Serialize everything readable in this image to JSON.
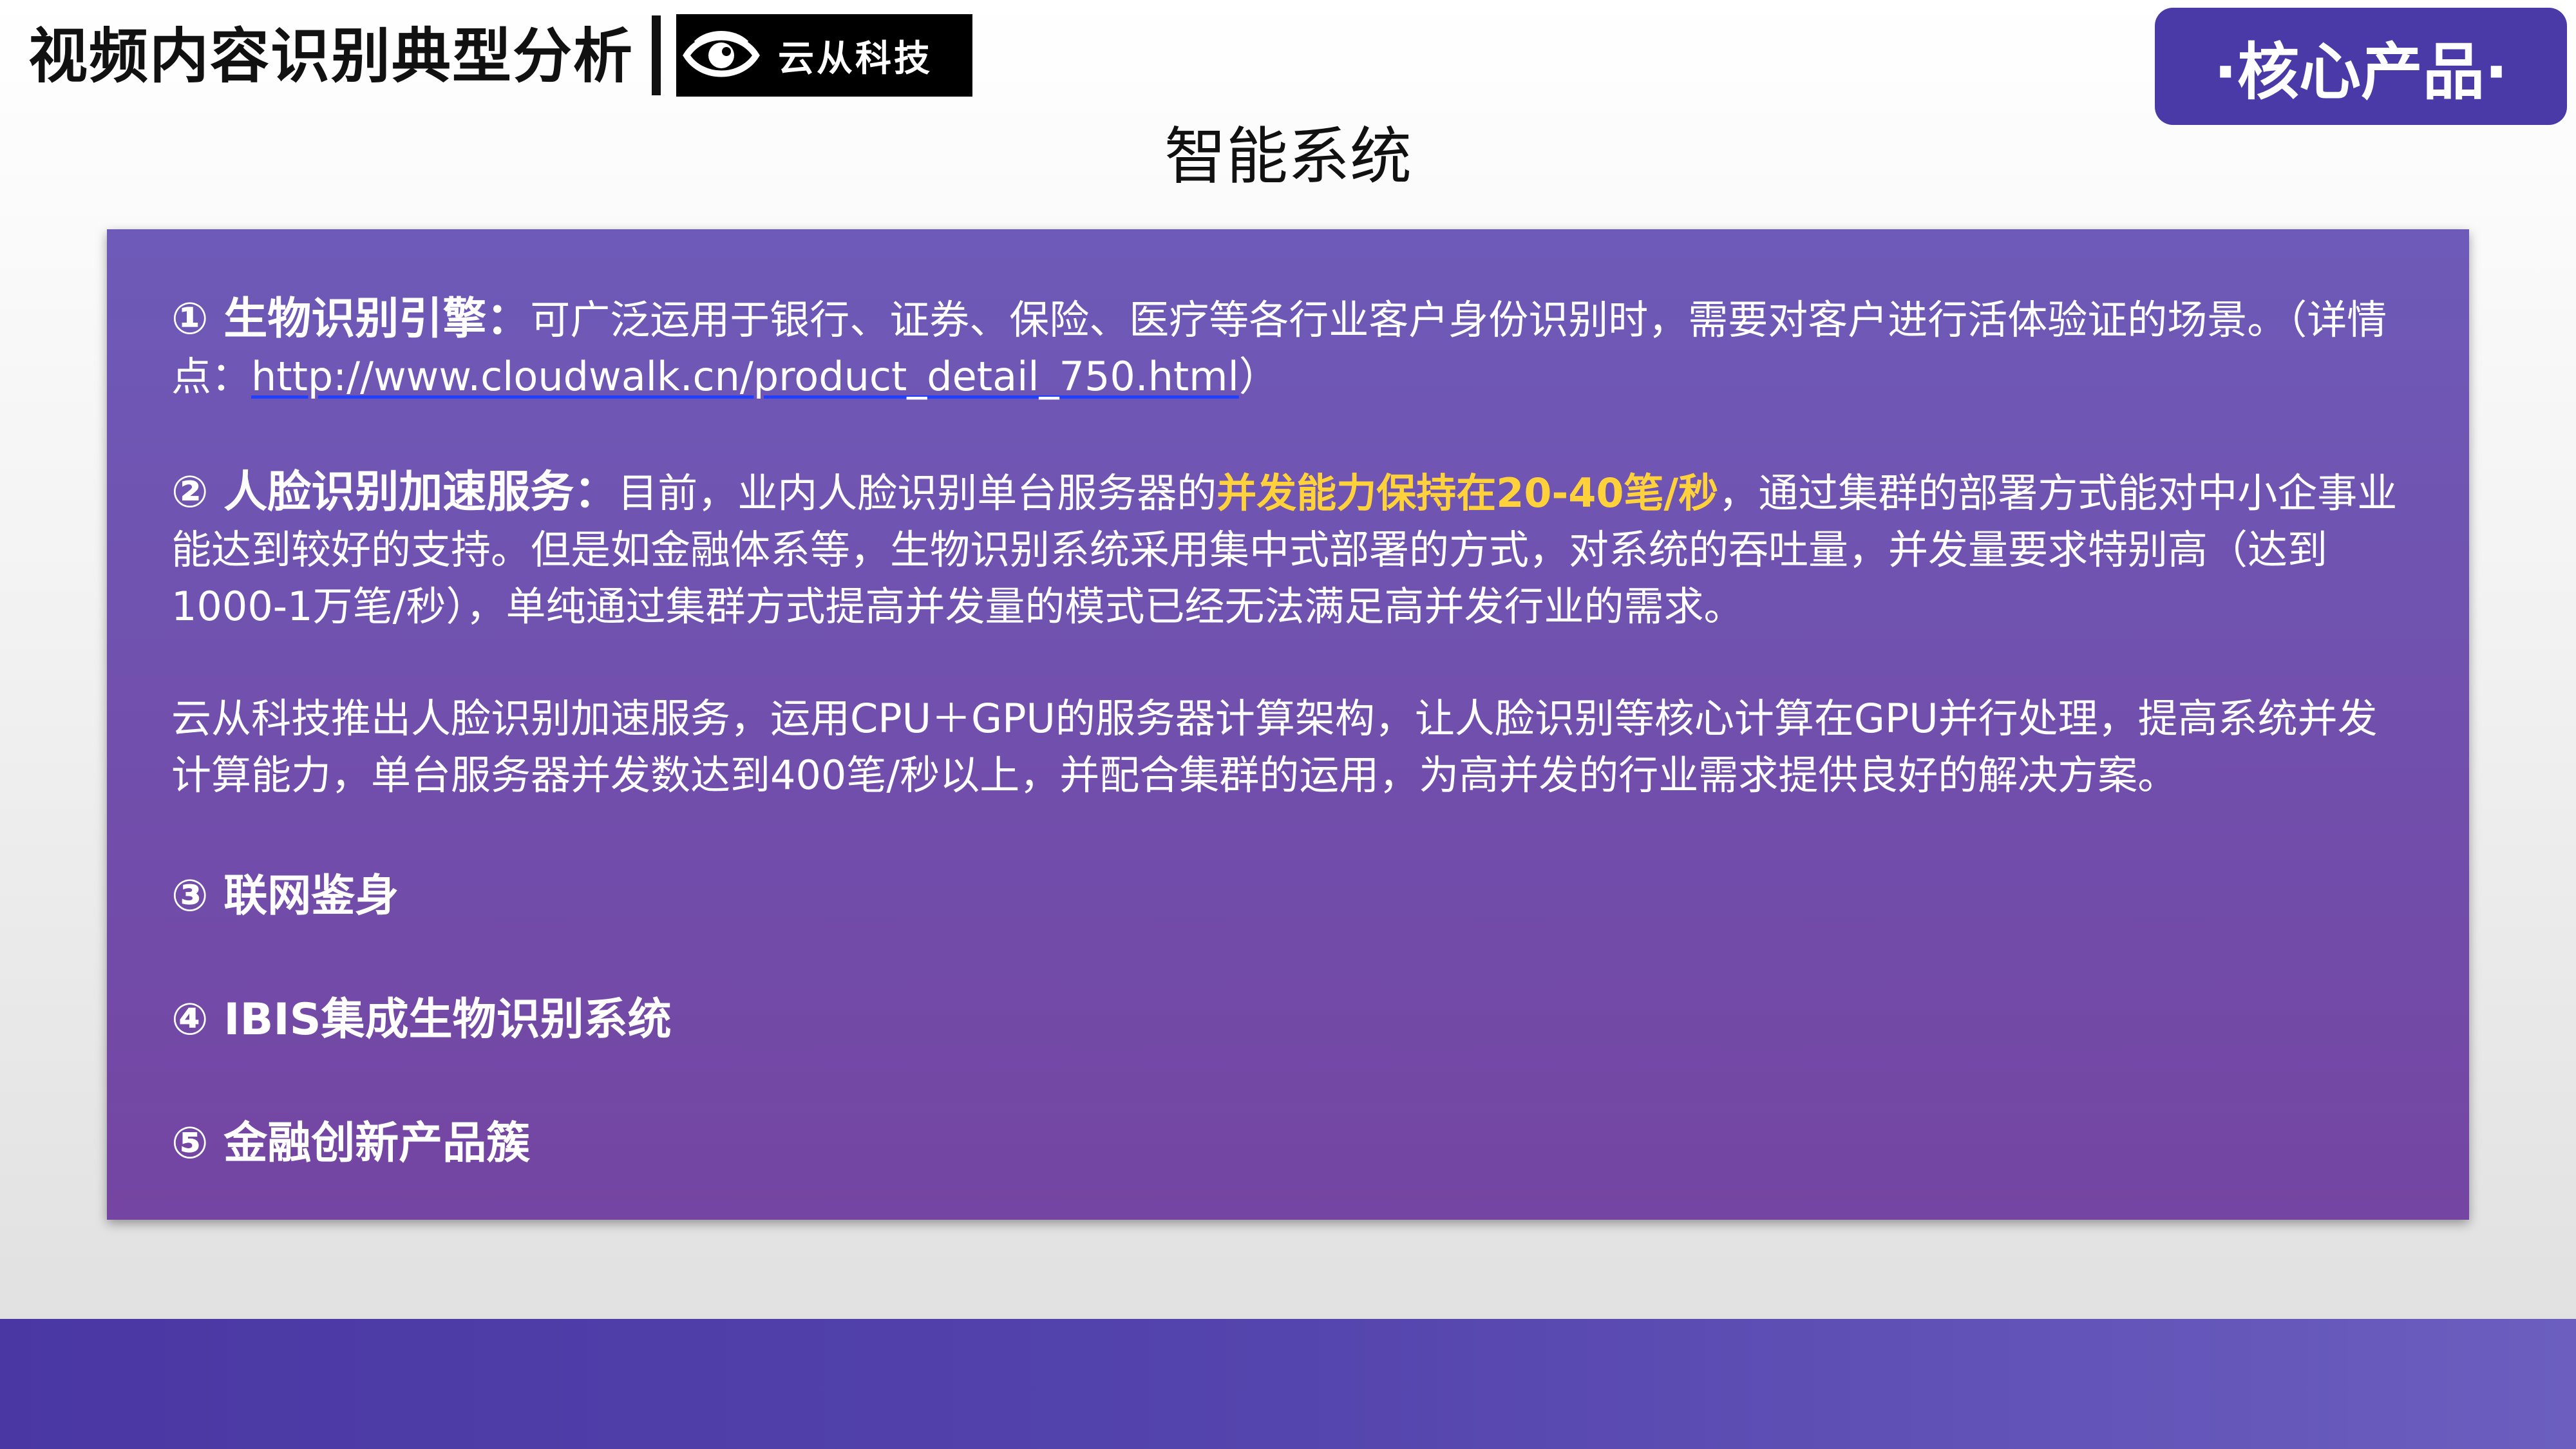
{
  "header": {
    "title": "视频内容识别典型分析",
    "logo_text": "云从科技",
    "logo_icon": "eye-icon",
    "badge": "·核心产品·"
  },
  "section_title": "智能系统",
  "items": {
    "biometric": {
      "heading": "① 生物识别引擎：",
      "text": "可广泛运用于银行、证券、保险、医疗等各行业客户身份识别时，需要对客户进行活体验证的场景。（详情点：",
      "link": "http://www.cloudwalk.cn/product_detail_750.html",
      "tail": "）"
    },
    "face_accel": {
      "heading": "② 人脸识别加速服务：",
      "pre": "目前，业内人脸识别单台服务器的",
      "highlight": "并发能力保持在20-40笔/秒",
      "post": "，通过集群的部署方式能对中小企事业能达到较好的支持。但是如金融体系等，生物识别系统采用集中式部署的方式，对系统的吞吐量，并发量要求特别高（达到1000-1万笔/秒），单纯通过集群方式提高并发量的模式已经无法满足高并发行业的需求。"
    },
    "cloudwalk_para": "云从科技推出人脸识别加速服务，运用CPU＋GPU的服务器计算架构，让人脸识别等核心计算在GPU并行处理，提高系统并发计算能力，单台服务器并发数达到400笔/秒以上，并配合集群的运用，为高并发的行业需求提供良好的解决方案。",
    "item3": "③ 联网鉴身",
    "item4": "④ IBIS集成生物识别系统",
    "item5": "⑤ 金融创新产品簇"
  },
  "colors": {
    "badge_bg": "#4a3aa8",
    "panel_top": "#6e5ab8",
    "panel_bottom": "#7445a2",
    "highlight": "#ffd23c",
    "footer": "#5444ad"
  }
}
